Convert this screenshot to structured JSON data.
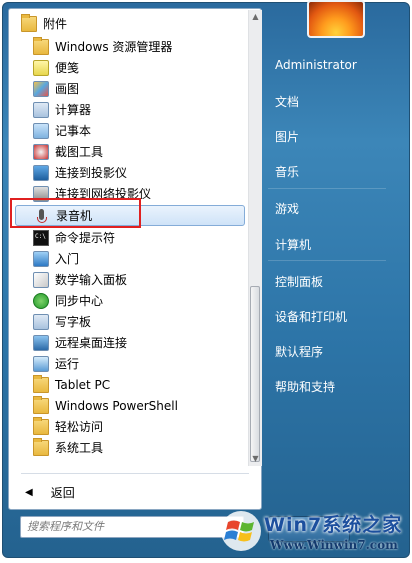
{
  "programs": {
    "folder_label": "附件",
    "items": [
      {
        "label": "Windows 资源管理器",
        "icon": "explorer-icon"
      },
      {
        "label": "便笺",
        "icon": "sticky-notes-icon"
      },
      {
        "label": "画图",
        "icon": "paint-icon"
      },
      {
        "label": "计算器",
        "icon": "calculator-icon"
      },
      {
        "label": "记事本",
        "icon": "notepad-icon"
      },
      {
        "label": "截图工具",
        "icon": "snipping-tool-icon"
      },
      {
        "label": "连接到投影仪",
        "icon": "projector-icon"
      },
      {
        "label": "连接到网络投影仪",
        "icon": "network-projector-icon"
      },
      {
        "label": "录音机",
        "icon": "sound-recorder-icon"
      },
      {
        "label": "命令提示符",
        "icon": "command-prompt-icon"
      },
      {
        "label": "入门",
        "icon": "getting-started-icon"
      },
      {
        "label": "数学输入面板",
        "icon": "math-input-icon"
      },
      {
        "label": "同步中心",
        "icon": "sync-center-icon"
      },
      {
        "label": "写字板",
        "icon": "wordpad-icon"
      },
      {
        "label": "远程桌面连接",
        "icon": "remote-desktop-icon"
      },
      {
        "label": "运行",
        "icon": "run-icon"
      },
      {
        "label": "Tablet PC",
        "icon": "folder-icon"
      },
      {
        "label": "Windows PowerShell",
        "icon": "folder-icon"
      },
      {
        "label": "轻松访问",
        "icon": "folder-icon"
      },
      {
        "label": "系统工具",
        "icon": "folder-icon"
      }
    ],
    "selected_index": 8,
    "back_label": "返回"
  },
  "search": {
    "placeholder": "搜索程序和文件"
  },
  "right_pane": {
    "links": [
      "Administrator",
      "文档",
      "图片",
      "音乐",
      "游戏",
      "计算机",
      "控制面板",
      "设备和打印机",
      "默认程序",
      "帮助和支持"
    ]
  },
  "watermark": {
    "brand_part1": "Win7",
    "brand_part2": "系统之家",
    "url": "Www.Winwin7.com"
  },
  "colors": {
    "frame": "#2d75a8",
    "selection": "#cfe3f8",
    "annotation": "#e02020"
  }
}
